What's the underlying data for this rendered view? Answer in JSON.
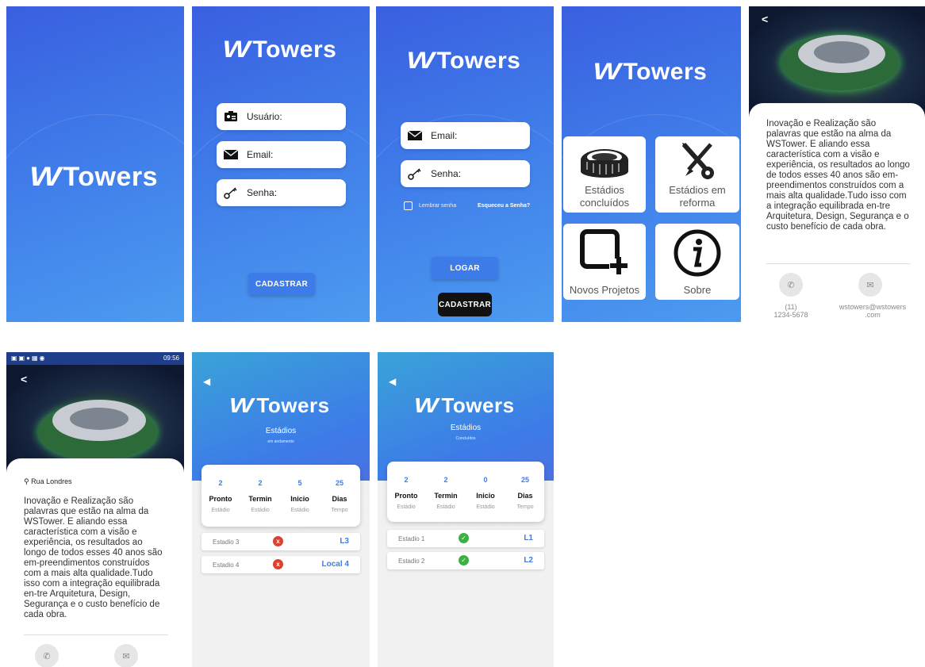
{
  "brand": {
    "logo_w": "W",
    "logo_text": "Towers"
  },
  "splash": {},
  "cadastro": {
    "usuario_label": "Usuário:",
    "email_label": "Email:",
    "senha_label": "Senha:",
    "cadastrar_label": "CADASTRAR"
  },
  "login": {
    "email_label": "Email:",
    "senha_label": "Senha:",
    "lembrar_label": "Lembrar senha",
    "esqueceu_label": "Esqueceu a Senha?",
    "logar_label": "LOGAR",
    "cadastrar_label": "CADASTRAR"
  },
  "menu": {
    "tiles": [
      {
        "label_1": "Estádios",
        "label_2": "concluídos",
        "icon": "stadium-icon"
      },
      {
        "label_1": "Estádios em",
        "label_2": "reforma",
        "icon": "tools-icon"
      },
      {
        "label_1": "Novos Projetos",
        "label_2": "",
        "icon": "add-project-icon"
      },
      {
        "label_1": "Sobre",
        "label_2": "",
        "icon": "info-icon"
      }
    ]
  },
  "sobre": {
    "back": "<",
    "text": "Inovação e Realização são palavras que estão na alma da WSTower. E aliando essa característica com a visão e experiência, os resultados ao longo de todos esses 40 anos são em-preendimentos construídos com a mais alta qualidade.Tudo isso com a integração equilibrada en-tre Arquitetura, Design, Segurança e o custo benefício de cada obra.",
    "phone_1": "(11)",
    "phone_2": "1234-5678",
    "email_1": "wstowers@wstowers",
    "email_2": ".com"
  },
  "detalhe": {
    "status_time": "09:56",
    "back": "<",
    "location": "Rua Londres",
    "text": "Inovação e Realização são palavras que estão na alma da WSTower. E aliando essa característica com a visão e experiência, os resultados ao longo de todos esses 40 anos são em-preendimentos construídos com a mais alta qualidade.Tudo isso com a integração equilibrada en-tre Arquitetura, Design, Segurança e o custo benefício de cada obra."
  },
  "andamento": {
    "title": "Estádios",
    "subtitle": "em andamento",
    "stats": [
      {
        "n": "2",
        "t": "Pronto",
        "s": "Estádio"
      },
      {
        "n": "2",
        "t": "Termin",
        "s": "Estádio"
      },
      {
        "n": "5",
        "t": "Inicio",
        "s": "Estádio"
      },
      {
        "n": "25",
        "t": "Dias",
        "s": "Tempo"
      }
    ],
    "rows": [
      {
        "name": "Estadio 3",
        "status": "x",
        "local": "L3"
      },
      {
        "name": "Estadio 4",
        "status": "x",
        "local": "Local 4"
      }
    ]
  },
  "concluidos": {
    "title": "Estádios",
    "subtitle": "Concluídos",
    "stats": [
      {
        "n": "2",
        "t": "Pronto",
        "s": "Estádio"
      },
      {
        "n": "2",
        "t": "Termin",
        "s": "Estádio"
      },
      {
        "n": "0",
        "t": "Inicio",
        "s": "Estádio"
      },
      {
        "n": "25",
        "t": "Dias",
        "s": "Tempo"
      }
    ],
    "rows": [
      {
        "name": "Estadio 1",
        "status": "✓",
        "local": "L1"
      },
      {
        "name": "Estadio 2",
        "status": "✓",
        "local": "L2"
      }
    ]
  },
  "colors": {
    "gradient_start": "#3a5fe0",
    "gradient_end": "#4c9bf0",
    "accent": "#3d7be8",
    "error": "#d9432f",
    "success": "#3cb043"
  }
}
